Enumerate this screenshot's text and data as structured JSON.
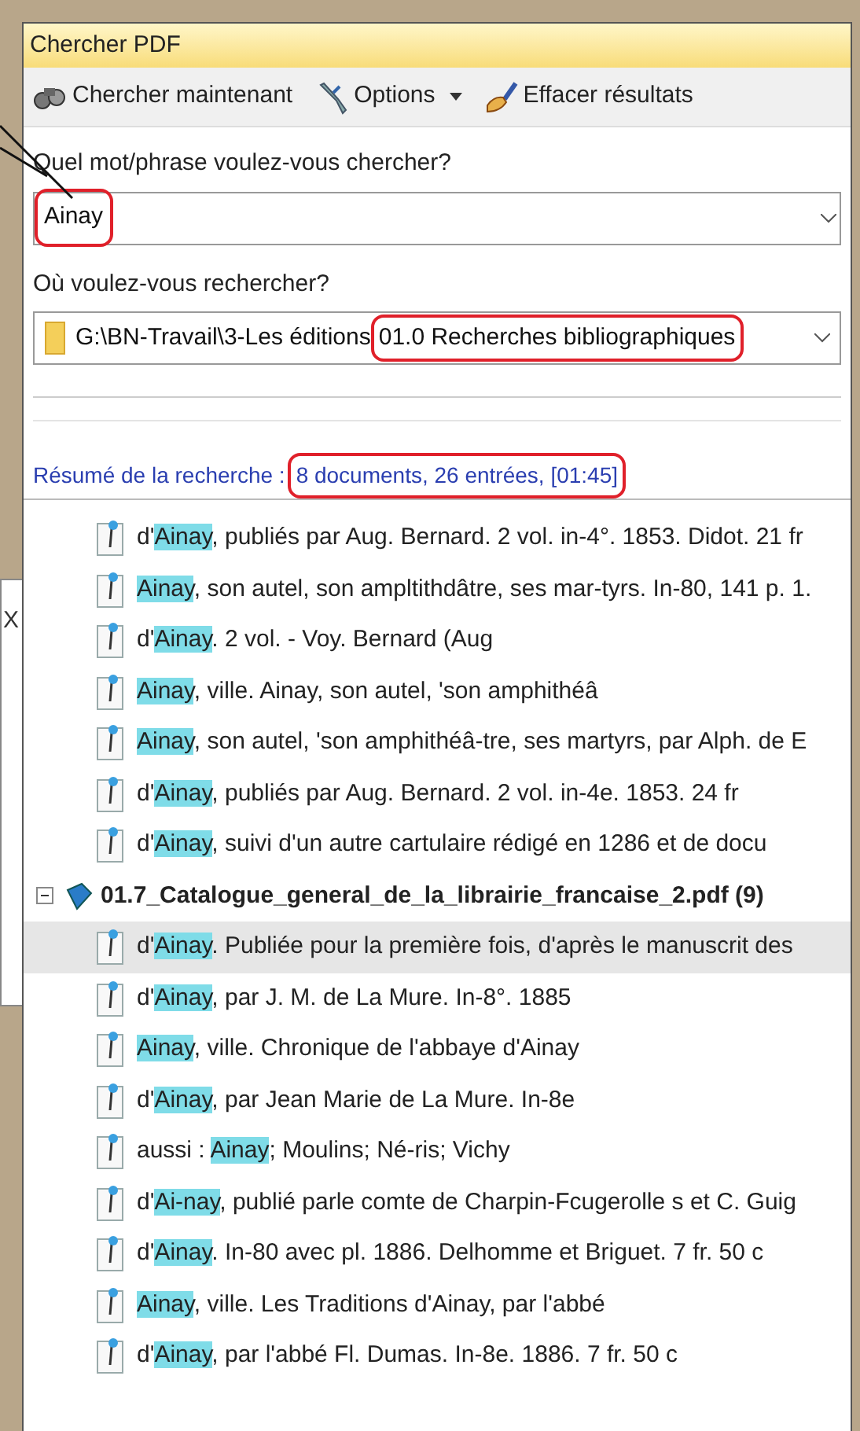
{
  "window": {
    "title": "Chercher PDF"
  },
  "toolbar": [
    {
      "kind": "search",
      "label": "Chercher maintenant",
      "dropdown": false
    },
    {
      "kind": "options",
      "label": "Options",
      "dropdown": true
    },
    {
      "kind": "clear",
      "label": "Effacer résultats",
      "dropdown": false
    }
  ],
  "query": {
    "label": "Quel mot/phrase voulez-vous chercher?",
    "value": "Ainay",
    "annotated": true
  },
  "location": {
    "label": "Où voulez-vous rechercher?",
    "path": "G:\\BN-Travail\\3-Les éditions",
    "folder": "01.0 Recherches bibliographiques",
    "annotated": true
  },
  "summary": {
    "label": "Résumé de la recherche :",
    "result": "8 documents, 26 entrées, [01:45]",
    "annotated": true
  },
  "results": [
    {
      "kind": "entry",
      "before": "d'",
      "match": "Ainay",
      "after": ", publiés par Aug. Bernard. 2 vol. in-4°. 1853. Didot. 21 fr",
      "selected": false
    },
    {
      "kind": "entry",
      "match": "Ainay",
      "after": ", son autel, son ampltithdâtre, ses mar-tyrs. In-80, 141 p. 1.",
      "selected": false
    },
    {
      "kind": "entry",
      "before": "d'",
      "match": "Ainay",
      "after": ". 2 vol. - Voy. Bernard (Aug",
      "selected": false
    },
    {
      "kind": "entry",
      "match": "Ainay",
      "after": ", ville. Ainay, son autel, 'son amphithéâ",
      "selected": false
    },
    {
      "kind": "entry",
      "match": "Ainay",
      "after": ", son autel, 'son amphithéâ-tre, ses martyrs, par Alph. de E",
      "selected": false
    },
    {
      "kind": "entry",
      "before": "d'",
      "match": "Ainay",
      "after": ", publiés par Aug. Bernard. 2 vol. in-4e. 1853. 24 fr",
      "selected": false
    },
    {
      "kind": "entry",
      "before": "d'",
      "match": "Ainay",
      "after": ", suivi d'un autre cartulaire rédigé en 1286 et de docu",
      "selected": false
    },
    {
      "kind": "document",
      "name": "01.7_Catalogue_general_de_la_librairie_francaise_2.pdf (9)",
      "expanded": true
    },
    {
      "kind": "entry",
      "before": "d'",
      "match": "Ainay",
      "after": ". Publiée pour la première fois, d'après le manuscrit des",
      "selected": true
    },
    {
      "kind": "entry",
      "before": "d'",
      "match": "Ainay",
      "after": ", par J. M. de La Mure. In-8°. 1885",
      "selected": false
    },
    {
      "kind": "entry",
      "match": "Ainay",
      "after": ", ville. Chronique de l'abbaye d'Ainay",
      "selected": false
    },
    {
      "kind": "entry",
      "before": "d'",
      "match": "Ainay",
      "after": ", par Jean Marie de La Mure. In-8e",
      "selected": false
    },
    {
      "kind": "entry",
      "before": "aussi : ",
      "match": "Ainay",
      "after": "; Moulins; Né-ris; Vichy",
      "selected": false
    },
    {
      "kind": "entry",
      "before": "d'",
      "match": "Ai-nay",
      "after": ", publié parle comte de Charpin-Fcugerolle s et C. Guig",
      "selected": false
    },
    {
      "kind": "entry",
      "before": "d'",
      "match": "Ainay",
      "after": ". In-80 avec pl. 1886. Delhomme et Briguet. 7 fr. 50 c",
      "selected": false
    },
    {
      "kind": "entry",
      "match": "Ainay",
      "after": ", ville. Les Traditions d'Ainay, par l'abbé",
      "selected": false
    },
    {
      "kind": "entry",
      "before": "d'",
      "match": "Ainay",
      "after": ", par l'abbé Fl. Dumas. In-8e. 1886. 7 fr. 50 c",
      "selected": false
    }
  ],
  "behind_window": {
    "close": "X"
  }
}
